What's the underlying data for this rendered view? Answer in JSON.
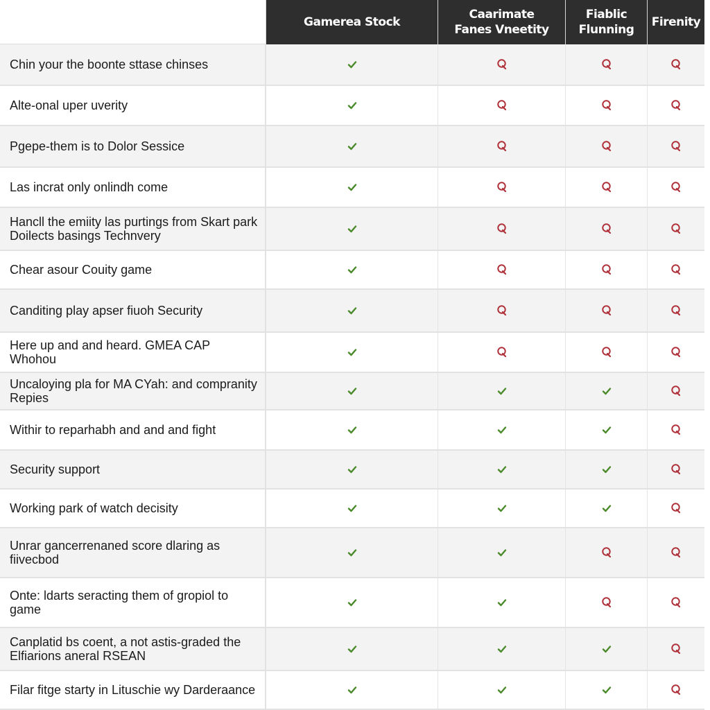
{
  "table": {
    "columns": [
      {
        "label": ""
      },
      {
        "label": "Gamerea Stock"
      },
      {
        "label": "Caarimate\nFanes Vneetity"
      },
      {
        "label": "Fiablic\nFlunning"
      },
      {
        "label": "Firenity"
      }
    ],
    "rows": [
      {
        "feature": "Chin your the boonte sttase chinses",
        "values": [
          "yes",
          "no",
          "no",
          "no"
        ]
      },
      {
        "feature": "Alte-onal uper uverity",
        "values": [
          "yes",
          "no",
          "no",
          "no"
        ]
      },
      {
        "feature": "Pgepe-them is to Dolor Sessice",
        "values": [
          "yes",
          "no",
          "no",
          "no"
        ]
      },
      {
        "feature": "Las incrat only onlindh come",
        "values": [
          "yes",
          "no",
          "no",
          "no"
        ]
      },
      {
        "feature": "Hancll the emiity las purtings from Skart park Doilects basings Technvery",
        "values": [
          "yes",
          "no",
          "no",
          "no"
        ]
      },
      {
        "feature": "Chear asour Couity game",
        "values": [
          "yes",
          "no",
          "no",
          "no"
        ]
      },
      {
        "feature": "Canditing play apser fiuoh Security",
        "values": [
          "yes",
          "no",
          "no",
          "no"
        ]
      },
      {
        "feature": "Here up and and heard. GMEA CAP Whohou",
        "values": [
          "yes",
          "no",
          "no",
          "no"
        ]
      },
      {
        "feature": "Uncaloying pla for MA CYah: and compranity Repies",
        "values": [
          "yes",
          "yes",
          "yes",
          "no"
        ]
      },
      {
        "feature": "Withir to reparhabh and and and fight",
        "values": [
          "yes",
          "yes",
          "yes",
          "no"
        ]
      },
      {
        "feature": "Security support",
        "values": [
          "yes",
          "yes",
          "yes",
          "no"
        ]
      },
      {
        "feature": "Working park of watch decisity",
        "values": [
          "yes",
          "yes",
          "yes",
          "no"
        ]
      },
      {
        "feature": "Unrar gancerrenaned score dlaring as fiivecbod",
        "values": [
          "yes",
          "yes",
          "no",
          "no"
        ]
      },
      {
        "feature": "Onte: ldarts seracting them of gropiol to game",
        "values": [
          "yes",
          "yes",
          "no",
          "no"
        ]
      },
      {
        "feature": "Canplatid bs coent, a not astis-graded the Elfiarions aneral RSEAN",
        "values": [
          "yes",
          "yes",
          "yes",
          "no"
        ]
      },
      {
        "feature": "Filar fitge starty in Lituschie wy Darderaance",
        "values": [
          "yes",
          "yes",
          "yes",
          "no"
        ]
      }
    ]
  },
  "icons": {
    "yes": "checkmark-icon",
    "no": "magnifier-q-icon"
  },
  "colors": {
    "header_bg": "#2e2e2e",
    "yes": "#4a8a2a",
    "no": "#b0303a"
  }
}
